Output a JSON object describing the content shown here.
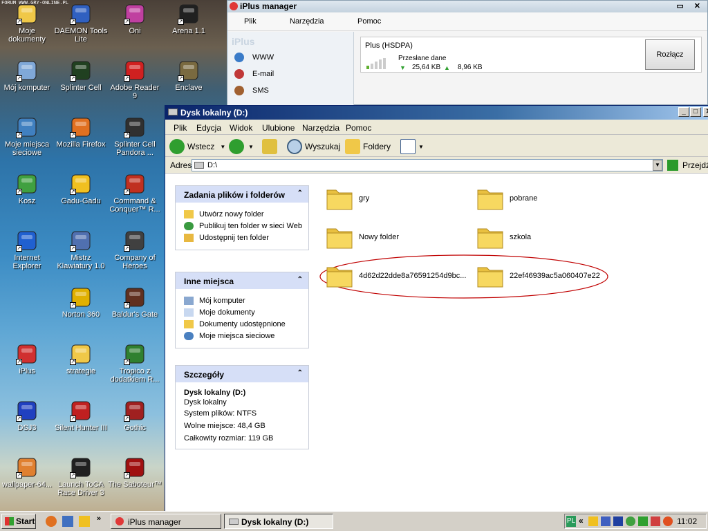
{
  "watermark": "FORUM WWW.GRY-ONLINE.PL",
  "desktop_icons": [
    {
      "label": "Moje dokumenty",
      "color": "#f0c848"
    },
    {
      "label": "DAEMON Tools Lite",
      "color": "#3060c0"
    },
    {
      "label": "Oni",
      "color": "#c040a0"
    },
    {
      "label": "Arena 1.1",
      "color": "#202020"
    },
    {
      "label": "Mój komputer",
      "color": "#80a8d8"
    },
    {
      "label": "Splinter Cell",
      "color": "#204020"
    },
    {
      "label": "Adobe Reader 9",
      "color": "#d02020"
    },
    {
      "label": "Enclave",
      "color": "#7a6a40"
    },
    {
      "label": "Moje miejsca sieciowe",
      "color": "#4080c0"
    },
    {
      "label": "Mozilla Firefox",
      "color": "#e07020"
    },
    {
      "label": "Splinter Cell Pandora ...",
      "color": "#303030"
    },
    {
      "label": "Kosz",
      "color": "#40a040"
    },
    {
      "label": "Gadu-Gadu",
      "color": "#f0c020"
    },
    {
      "label": "Command & Conquer™ R...",
      "color": "#c03020"
    },
    {
      "label": "Internet Explorer",
      "color": "#2060d0"
    },
    {
      "label": "Mistrz Klawiatury 1.0",
      "color": "#5070b0"
    },
    {
      "label": "Company of Heroes",
      "color": "#404040"
    },
    {
      "label": "Norton 360",
      "color": "#e0b000"
    },
    {
      "label": "Baldur's Gate",
      "color": "#603020"
    },
    {
      "label": "iPlus",
      "color": "#d03030"
    },
    {
      "label": "strategie",
      "color": "#f0c848"
    },
    {
      "label": "Tropico z dodatkiem R...",
      "color": "#308030"
    },
    {
      "label": "DSJ3",
      "color": "#2040c0"
    },
    {
      "label": "Silent Hunter III",
      "color": "#c02020"
    },
    {
      "label": "Gothic",
      "color": "#a02020"
    },
    {
      "label": "wallpaper-64...",
      "color": "#e08030"
    },
    {
      "label": "Launch ToCA Race Driver 3",
      "color": "#202020"
    },
    {
      "label": "The Saboteur™",
      "color": "#a01010"
    }
  ],
  "iplus": {
    "title": "iPlus manager",
    "window_buttons": "▭ ✕",
    "menu": [
      "Plik",
      "Narzędzia",
      "Pomoc"
    ],
    "brand": "iPlus",
    "nav": [
      {
        "label": "WWW",
        "color": "#3a7bc8"
      },
      {
        "label": "E-mail",
        "color": "#c03838"
      },
      {
        "label": "SMS",
        "color": "#a06030"
      }
    ],
    "network": "Plus (HSDPA)",
    "sent_label": "Przesłane dane",
    "download": "25,64 KB",
    "upload": "8,96 KB",
    "disconnect": "Rozłącz"
  },
  "explorer": {
    "title": "Dysk lokalny (D:)",
    "menu": [
      "Plik",
      "Edycja",
      "Widok",
      "Ulubione",
      "Narzędzia",
      "Pomoc"
    ],
    "toolbar": {
      "back": "Wstecz",
      "search": "Wyszukaj",
      "folders": "Foldery"
    },
    "address_label": "Adres",
    "address": "D:\\",
    "go": "Przejdź",
    "tasks": {
      "title": "Zadania plików i folderów",
      "items": [
        "Utwórz nowy folder",
        "Publikuj ten folder w sieci Web",
        "Udostępnij ten folder"
      ]
    },
    "places": {
      "title": "Inne miejsca",
      "items": [
        "Mój komputer",
        "Moje dokumenty",
        "Dokumenty udostępnione",
        "Moje miejsca sieciowe"
      ]
    },
    "details": {
      "title": "Szczegóły",
      "name": "Dysk lokalny (D:)",
      "type": "Dysk lokalny",
      "fs": "System plików: NTFS",
      "free": "Wolne miejsce: 48,4 GB",
      "total": "Całkowity rozmiar: 119 GB"
    },
    "folders": [
      "gry",
      "pobrane",
      "Nowy folder",
      "szkola",
      "4d62d22dde8a76591254d9bc...",
      "22ef46939ac5a060407e22"
    ]
  },
  "taskbar": {
    "start": "Start",
    "tasks": [
      "iPlus manager",
      "Dysk lokalny (D:)"
    ],
    "lang": "PL",
    "clock": "11:02"
  }
}
